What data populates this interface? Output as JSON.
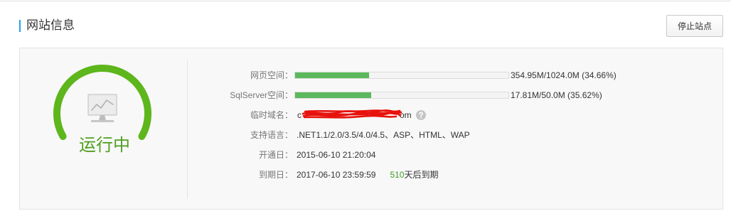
{
  "header": {
    "title": "网站信息",
    "stop_button_label": "停止站点"
  },
  "status": {
    "label": "运行中",
    "icon": "monitor-chart-icon"
  },
  "info": {
    "web_space": {
      "label": "网页空间：",
      "usage_text": "354.95M/1024.0M (34.66%)",
      "percent": 34.66
    },
    "sql_space": {
      "label": "SqlServer空间：",
      "usage_text": "17.81M/50.0M (35.62%)",
      "percent": 35.62
    },
    "temp_domain": {
      "label": "临时域名：",
      "visible_start": "c",
      "visible_end": "om",
      "help_icon": "question-circle-icon"
    },
    "languages": {
      "label": "支持语言：",
      "value": ".NET1.1/2.0/3.5/4.0/4.5、ASP、HTML、WAP"
    },
    "open_date": {
      "label": "开通日：",
      "value": "2015-06-10 21:20:04"
    },
    "expire_date": {
      "label": "到期日：",
      "value": "2017-06-10 23:59:59",
      "days_left": "510",
      "days_left_suffix": "天后到期"
    }
  },
  "colors": {
    "accent": "#2b9fe4",
    "running": "#5db61c",
    "status_text": "#4f9f1f",
    "progress_fill": "#5cb85c",
    "days_left": "#3f9a26",
    "redaction": "#e8120c"
  }
}
